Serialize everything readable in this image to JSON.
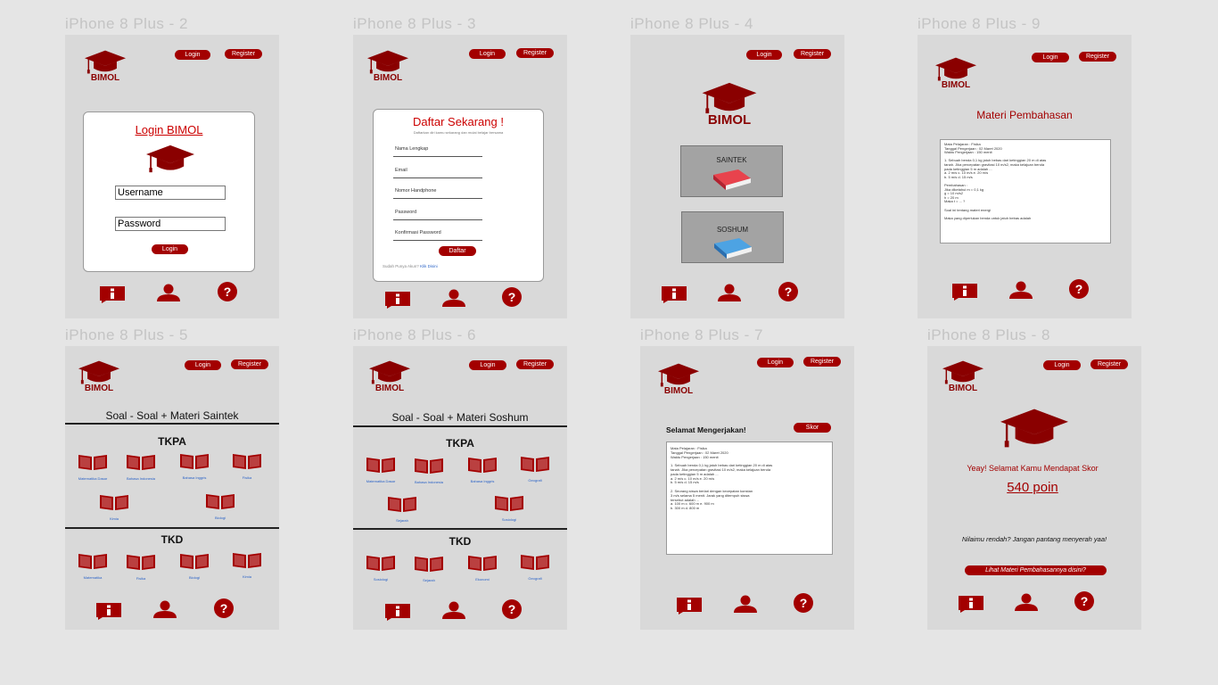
{
  "colors": {
    "brand": "#a30000",
    "frame_bg": "#d9d9d9",
    "canvas_bg": "#e5e5e5",
    "link": "#2b63c7"
  },
  "brand": {
    "logo_text": "BIMOL"
  },
  "header": {
    "login": "Login",
    "register": "Register"
  },
  "icons": [
    "info-icon",
    "user-icon",
    "help-icon",
    "graduation-cap-icon",
    "book-icon"
  ],
  "frames": {
    "f2": {
      "title": "iPhone 8 Plus - 2",
      "card_title": "Login BIMOL",
      "username": "Username",
      "password": "Password",
      "button": "Login"
    },
    "f3": {
      "title": "iPhone 8 Plus - 3",
      "card_title": "Daftar Sekarang !",
      "subtitle": "Daftarkan diri kamu sekarang dan mulai belajar bersama",
      "fields": [
        "Nama Lengkap",
        "Email",
        "Nomor Handphone",
        "Password",
        "Konfirmasi Password"
      ],
      "button": "Daftar",
      "footer": "Sudah Punya Akun?",
      "footer_link": "Klik Disini"
    },
    "f4": {
      "title": "iPhone 8 Plus - 4",
      "option1": "SAINTEK",
      "option2": "SOSHUM"
    },
    "f9": {
      "title": "iPhone 8 Plus - 9",
      "heading": "Materi Pembahasan",
      "doc": "Mata Pelajaran : Fisika\nTanggal Pengerjaan : 02 Maret 2020\nWaktu Pengerjaan : 150 menit\n\n1. Sebuah benda 0,1 kg jatuh bebas dari ketinggian 20 m di atas\n   tanah. Jika percepatan gravitasi 10 m/s2, maka kelajuan benda\n   pada ketinggian 5 m adalah ...\n   a. 2 m/s  c. 10 m/s  e. 20 m/s\n   b. 5 m/s  d. 15 m/s\n\nPembahasan :\nJika diketahui m = 0,1 kg\n   g = 10 m/s2\n   h = 20 m\nMaka t = ... ?\n\nSoal ini tentang materi energi\n\nMaka yang diperlukan benda untuk jatuh bebas adalah"
    },
    "f5": {
      "title": "iPhone 8 Plus - 5",
      "heading": "Soal - Soal + Materi Saintek",
      "sec1": "TKPA",
      "sec2": "TKD",
      "sec1_items": [
        "Matematika Dasar",
        "Bahasa Indonesia",
        "Bahasa Inggris",
        "Fisika",
        "Kimia",
        "Biologi"
      ],
      "sec2_items": [
        "Matematika",
        "Fisika",
        "Biologi",
        "Kimia"
      ]
    },
    "f6": {
      "title": "iPhone 8 Plus - 6",
      "heading": "Soal - Soal + Materi Soshum",
      "sec1": "TKPA",
      "sec2": "TKD",
      "sec1_items": [
        "Matematika Dasar",
        "Bahasa Indonesia",
        "Bahasa Inggris",
        "Geografi",
        "Sejarah",
        "Sosiologi"
      ],
      "sec2_items": [
        "Sosiologi",
        "Sejarah",
        "Ekonomi",
        "Geografi"
      ]
    },
    "f7": {
      "title": "iPhone 8 Plus - 7",
      "heading": "Selamat Mengerjakan!",
      "button": "Skor",
      "doc": "Mata Pelajaran : Fisika\nTanggal Pengerjaan : 02 Maret 2020\nWaktu Pengerjaan : 150 menit\n\n1. Sebuah benda 0,1 kg jatuh bebas dari ketinggian 20 m di atas\n   tanah. Jika percepatan gravitasi 10 m/s2, maka kelajuan benda\n   pada ketinggian 5 m adalah ...\n   a. 2 m/s  c. 10 m/s  e. 20 m/s\n   b. 5 m/s  d. 15 m/s\n\n2. Seorang siswa berlari dengan kecepatan konstan\n   3 m/s selama 5 menit. Jarak yang ditempuh siswa\n   tersebut adalah ...\n   a. 100 m  c. 600 m  e. 900 m\n   b. 300 m  d. 800 m"
    },
    "f8": {
      "title": "iPhone 8 Plus - 8",
      "congrats": "Yeay! Selamat Kamu Mendapat Skor",
      "score": "540 poin",
      "motivation": "Nilaimu rendah? Jangan pantang menyerah yaa!",
      "button": "Lihat Materi Pembahasannya disini?"
    }
  }
}
